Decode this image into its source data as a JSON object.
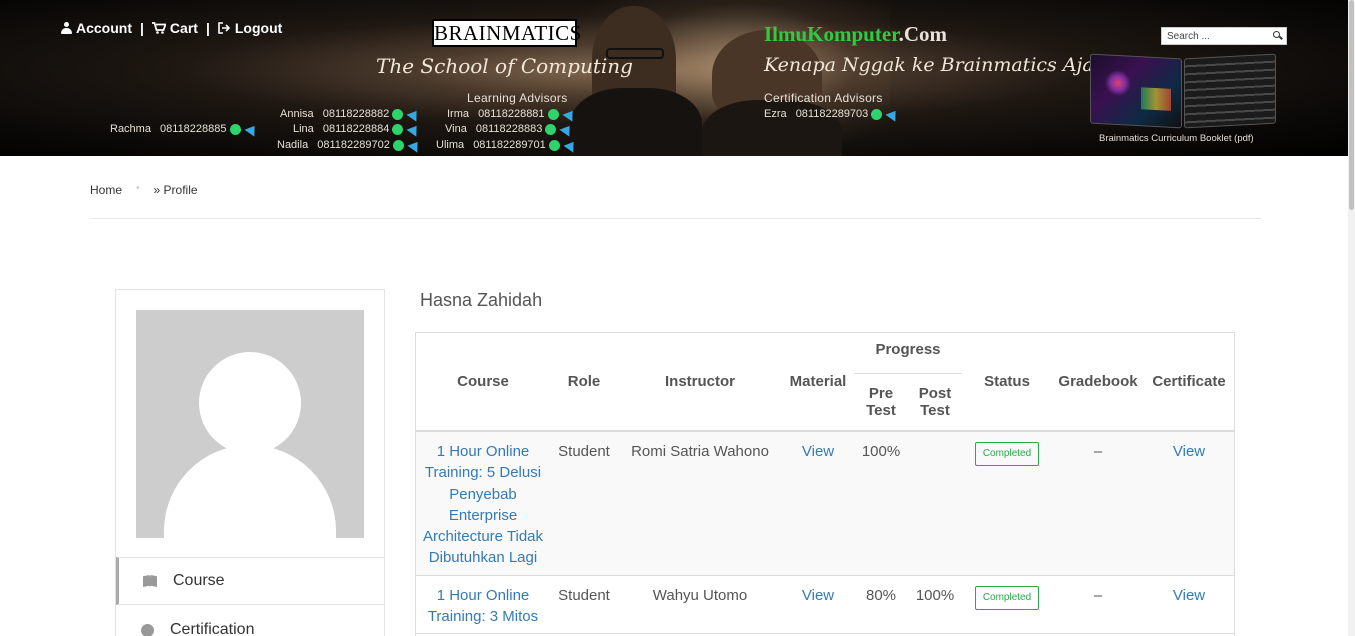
{
  "topnav": {
    "account": "Account",
    "cart": "Cart",
    "logout": "Logout",
    "sep": "|"
  },
  "banner": {
    "brand": "BRAINMATICS",
    "brand_sub": "The School of Computing",
    "learning_label": "Learning Advisors",
    "learning_contacts": [
      {
        "name": "Rachma",
        "phone": "08118228885"
      },
      {
        "name": "Annisa",
        "phone": "08118228882"
      },
      {
        "name": "Lina",
        "phone": "08118228884"
      },
      {
        "name": "Nadila",
        "phone": "081182289702"
      },
      {
        "name": "Irma",
        "phone": "08118228881"
      },
      {
        "name": "Vina",
        "phone": "08118228883"
      },
      {
        "name": "Ulima",
        "phone": "081182289701"
      }
    ],
    "ilmu_main": "IlmuKomputer",
    "ilmu_suffix": ".Com",
    "tagline": "Kenapa Nggak ke Brainmatics Aja?",
    "cert_label": "Certification Advisors",
    "cert_contact": {
      "name": "Ezra",
      "phone": "081182289703"
    },
    "booklet_label": "Brainmatics Curriculum Booklet (pdf)"
  },
  "search": {
    "placeholder": "Search ..."
  },
  "breadcrumb": {
    "home": "Home",
    "dot": "•",
    "current": "» Profile"
  },
  "profile": {
    "name": "Hasna Zahidah",
    "menu": {
      "course": "Course",
      "certification": "Certification"
    }
  },
  "table": {
    "headers": {
      "course": "Course",
      "role": "Role",
      "instructor": "Instructor",
      "material": "Material",
      "progress": "Progress",
      "pre_test": "Pre Test",
      "post_test": "Post Test",
      "status": "Status",
      "gradebook": "Gradebook",
      "certificate": "Certificate"
    },
    "rows": [
      {
        "course": "1 Hour Online Training: 5 Delusi Penyebab Enterprise Architecture Tidak Dibutuhkan Lagi",
        "role": "Student",
        "instructor": "Romi Satria Wahono",
        "material": "View",
        "pre_test": "100%",
        "post_test": "",
        "status": "Completed",
        "gradebook": "–",
        "certificate": "View"
      },
      {
        "course": "1 Hour Online Training: 3 Mitos",
        "role": "Student",
        "instructor": "Wahyu Utomo",
        "material": "View",
        "pre_test": "80%",
        "post_test": "100%",
        "status": "Completed",
        "gradebook": "–",
        "certificate": "View"
      }
    ]
  }
}
